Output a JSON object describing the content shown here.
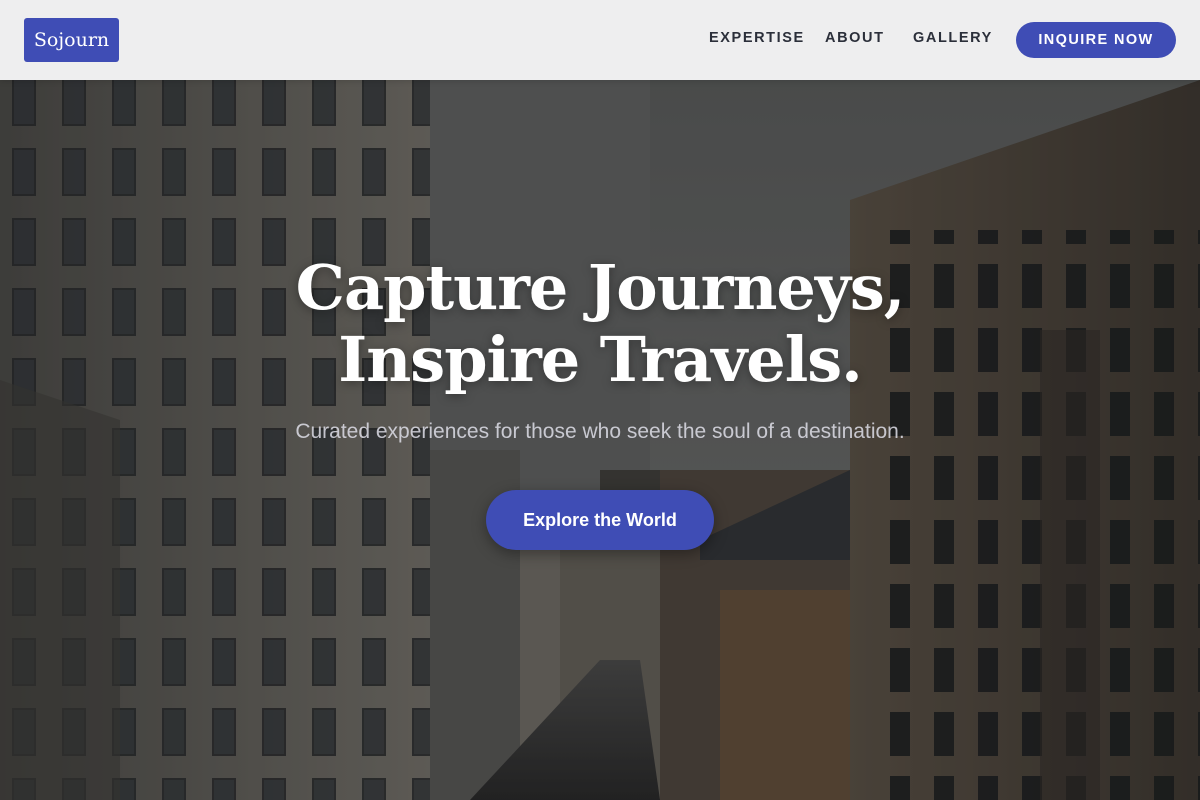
{
  "header": {
    "logo_text": "Sojourn",
    "nav": {
      "expertise": "EXPERTISE",
      "about": "ABOUT",
      "gallery": "GALLERY"
    },
    "cta_label": "INQUIRE NOW"
  },
  "hero": {
    "title_line1": "Capture Journeys,",
    "title_line2": "Inspire Travels.",
    "subtitle": "Curated experiences for those who seek the soul of a destination.",
    "cta_label": "Explore the World",
    "background_image": "narrow-city-street-between-buildings"
  },
  "colors": {
    "accent": "#3f4db5",
    "header_bg": "#f5f5f6",
    "nav_text": "#2b2f3a",
    "hero_text": "#ffffff"
  }
}
